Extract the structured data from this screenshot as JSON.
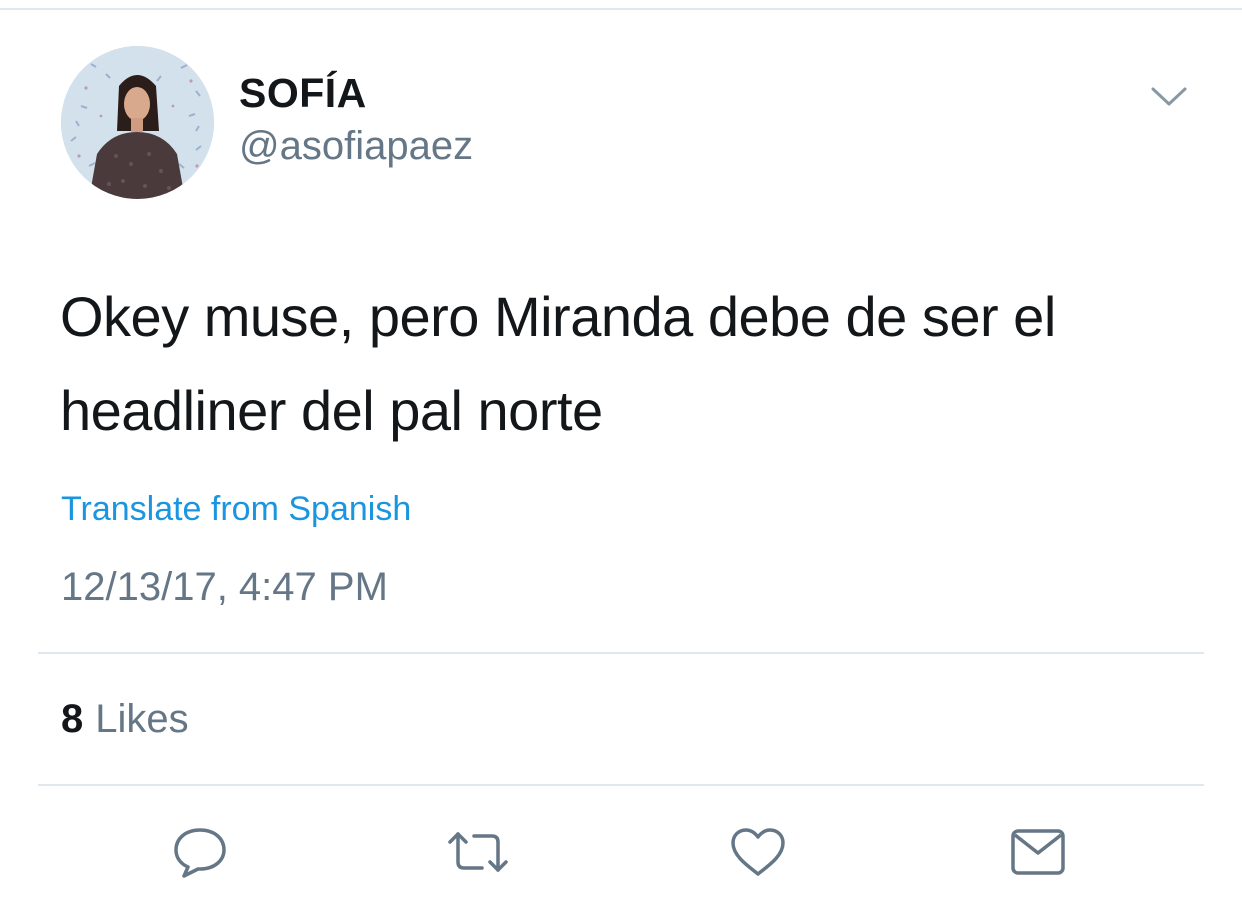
{
  "tweet": {
    "author": {
      "display_name": "SOFÍA",
      "handle": "@asofiapaez"
    },
    "text": "Okey muse, pero Miranda debe de ser el headliner del pal norte",
    "translate_label": "Translate from Spanish",
    "timestamp": "12/13/17, 4:47 PM",
    "likes": {
      "count": "8",
      "label": "Likes"
    }
  },
  "actions": [
    {
      "icon": "reply-icon"
    },
    {
      "icon": "retweet-icon"
    },
    {
      "icon": "like-icon"
    },
    {
      "icon": "direct-message-icon"
    }
  ],
  "colors": {
    "text": "#14171a",
    "secondary": "#657786",
    "link": "#1b95e0",
    "divider": "#e1e8ed"
  }
}
